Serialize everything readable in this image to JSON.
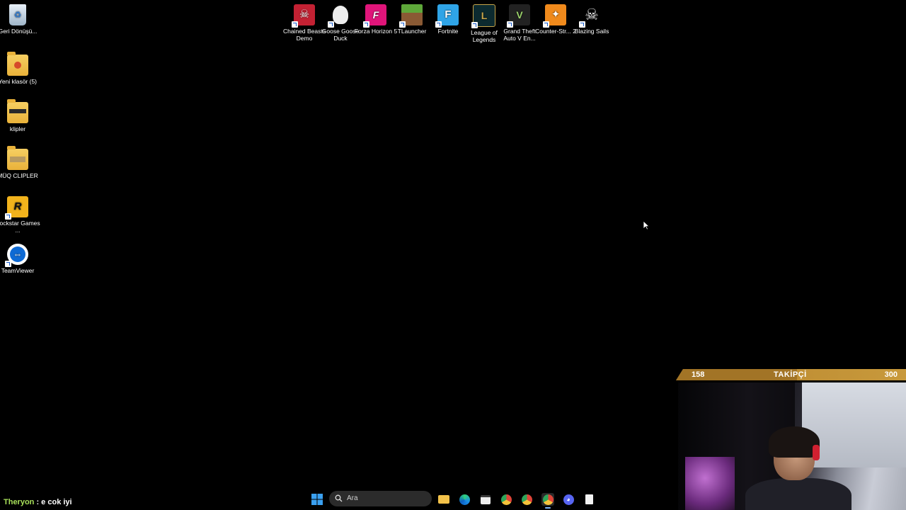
{
  "desktop_left": [
    {
      "name": "recycle-bin",
      "label": "Geri Dönüşü..."
    },
    {
      "name": "new-folder",
      "label": "Yeni klasör (5)"
    },
    {
      "name": "klipler-folder",
      "label": "klipler"
    },
    {
      "name": "muq-clipler-folder",
      "label": "MÜQ CLIPLER"
    },
    {
      "name": "rockstar-games",
      "label": "Rockstar Games ..."
    },
    {
      "name": "teamviewer",
      "label": "TeamViewer"
    }
  ],
  "desktop_top": [
    {
      "name": "chained-beasts",
      "label": "Chained Beasts Demo"
    },
    {
      "name": "goose-goose-duck",
      "label": "Goose Goose Duck"
    },
    {
      "name": "forza-horizon",
      "label": "Forza Horizon 5"
    },
    {
      "name": "tlauncher",
      "label": "TLauncher"
    },
    {
      "name": "fortnite",
      "label": "Fortnite"
    },
    {
      "name": "league-of-legends",
      "label": "League of Legends"
    },
    {
      "name": "gta-v",
      "label": "Grand Theft Auto V En..."
    },
    {
      "name": "counter-strike",
      "label": "Counter-Str... 2"
    },
    {
      "name": "blazing-sails",
      "label": "Blazing Sails"
    }
  ],
  "follower_goal": {
    "current": "158",
    "title": "TAKİPÇİ",
    "goal": "300",
    "progress": 0.527
  },
  "chat": {
    "user": "Theryon",
    "message": " : e cok iyi"
  },
  "taskbar": {
    "search_placeholder": "Ara"
  }
}
